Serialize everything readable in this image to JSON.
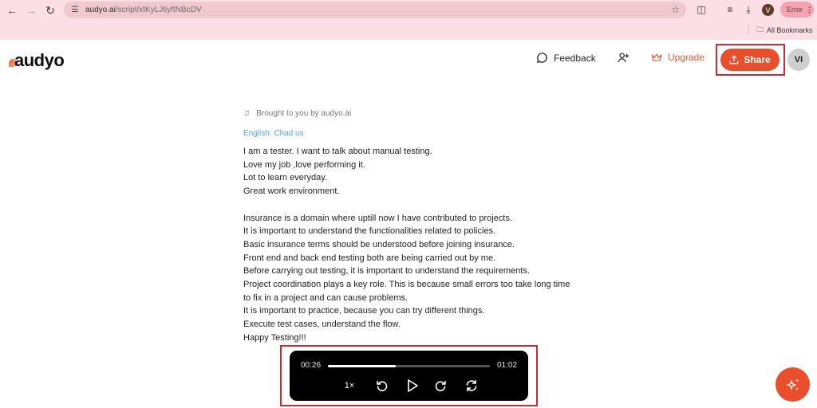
{
  "browser": {
    "url_host": "audyo.ai",
    "url_path": "/script/xtKyLJtiyftNBcDV",
    "profile_initial": "V",
    "error_label": "Error",
    "bookmarks_label": "All Bookmarks",
    "icons": [
      "back-icon",
      "forward-icon",
      "reload-icon",
      "site-settings-icon",
      "star-icon",
      "extensions-icon",
      "media-icon",
      "download-icon",
      "menu-dots-icon",
      "folder-icon"
    ]
  },
  "header": {
    "logo": "audyo",
    "feedback_label": "Feedback",
    "upgrade_label": "Upgrade",
    "share_label": "Share",
    "avatar_initials": "VI"
  },
  "content": {
    "brought_by": "Brought to you by audyo.ai",
    "voice": "English: Chad us",
    "paragraph1": [
      "I am a tester. I want to talk about manual testing.",
      "Love my job ,love performing it.",
      "Lot to learn everyday.",
      "Great work environment."
    ],
    "paragraph2": [
      "Insurance is a domain where uptill now I have contributed to projects.",
      "It is important to understand the functionalities related to policies.",
      "Basic insurance terms should be understood before joining insurance.",
      "Front end and back end testing both are being carried out by me.",
      "Before carrying out testing, it is important to understand the requirements.",
      "Project coordination plays a key role. This is because small errors too take long time to fix in a project and can cause problems.",
      "It is important to practice, because you can try different things.",
      "Execute test cases, understand the flow.",
      "Happy Testing!!!"
    ]
  },
  "player": {
    "current_time": "00:26",
    "duration": "01:02",
    "progress_percent": 42,
    "speed": "1×"
  },
  "colors": {
    "accent": "#e94f2c",
    "highlight_outline": "#cc2b36",
    "voice_link": "#5aa0dd"
  }
}
